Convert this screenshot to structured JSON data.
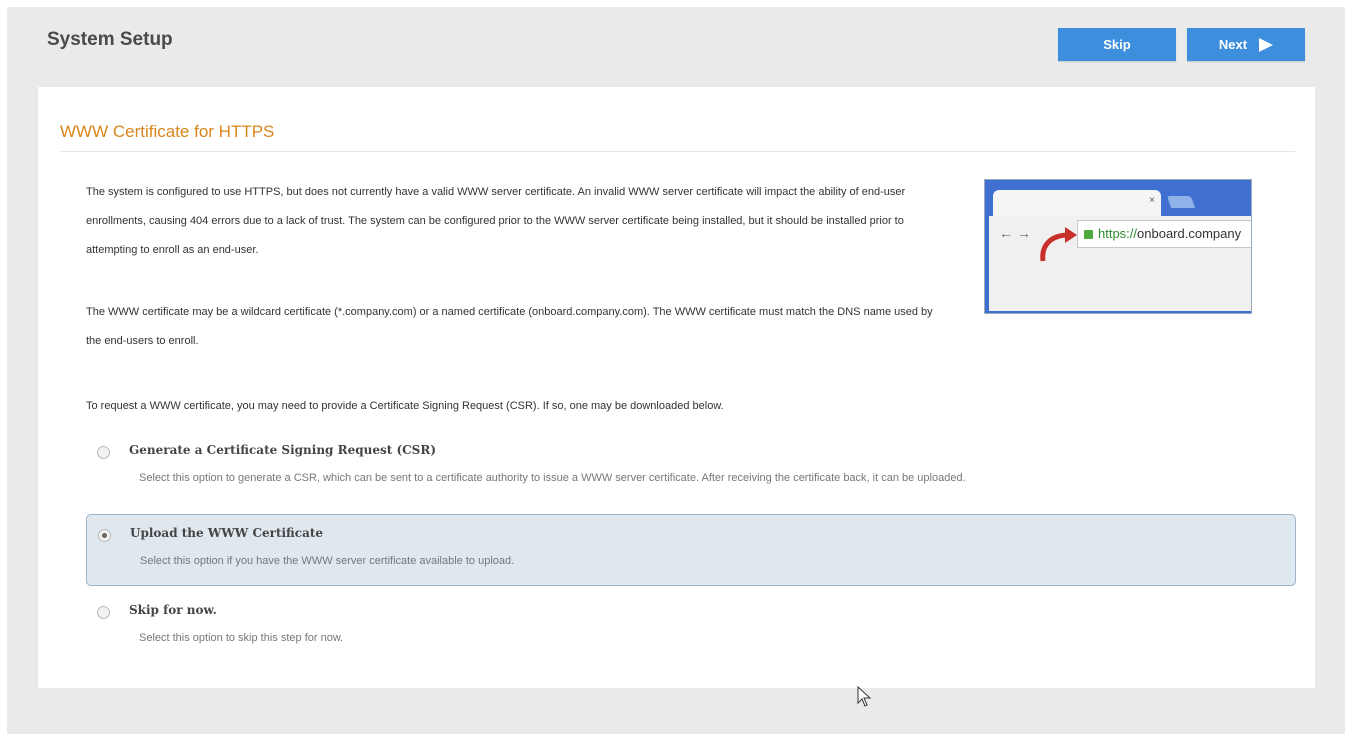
{
  "header": {
    "title": "System Setup",
    "skip_label": "Skip",
    "next_label": "Next"
  },
  "section": {
    "title": "WWW Certificate for HTTPS"
  },
  "paragraphs": [
    "The system is configured to use HTTPS, but does not currently have a valid WWW server certificate. An invalid WWW server certificate will impact the ability of end-user enrollments, causing 404 errors due to a lack of trust. The system can be configured prior to the WWW server certificate being installed, but it should be installed prior to attempting to enroll as an end-user.",
    "The WWW certificate may be a wildcard certificate (*.company.com) or a named certificate (onboard.company.com). The WWW certificate must match the DNS name used by the end-users to enroll.",
    "To request a WWW certificate, you may need to provide a Certificate Signing Request (CSR). If so, one may be downloaded below."
  ],
  "browser_illustration": {
    "tab_close": "×",
    "back_forward": "← →",
    "url_scheme": "https://",
    "url_host": "onboard.company"
  },
  "options": [
    {
      "label": "Generate a Certificate Signing Request (CSR)",
      "description": "Select this option to generate a CSR, which can be sent to a certificate authority to issue a WWW server certificate. After receiving the certificate back, it can be uploaded.",
      "selected": false
    },
    {
      "label": "Upload the WWW Certificate",
      "description": "Select this option if you have the WWW server certificate available to upload.",
      "selected": true
    },
    {
      "label": "Skip for now.",
      "description": "Select this option to skip this step for now.",
      "selected": false
    }
  ],
  "colors": {
    "button": "#3d8fde",
    "section_title": "#d9861c",
    "selected_bg": "#dfe7ef"
  }
}
